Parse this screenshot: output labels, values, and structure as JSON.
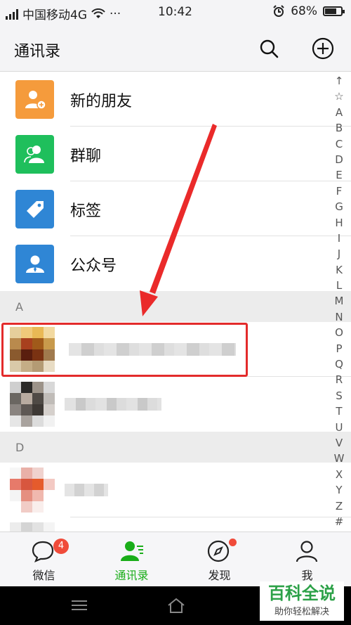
{
  "status_bar": {
    "carrier": "中国移动4G",
    "more": "···",
    "time": "10:42",
    "battery": "68%"
  },
  "header": {
    "title": "通讯录"
  },
  "functions": [
    {
      "label": "新的朋友",
      "color": "#f59b3c",
      "icon": "add-friend-icon"
    },
    {
      "label": "群聊",
      "color": "#1fbf5c",
      "icon": "group-chat-icon"
    },
    {
      "label": "标签",
      "color": "#2f86d5",
      "icon": "tag-icon"
    },
    {
      "label": "公众号",
      "color": "#2f86d5",
      "icon": "official-account-icon"
    }
  ],
  "sections": [
    "A",
    "D"
  ],
  "index_letters": [
    "↑",
    "☆",
    "A",
    "B",
    "C",
    "D",
    "E",
    "F",
    "G",
    "H",
    "I",
    "J",
    "K",
    "L",
    "M",
    "N",
    "O",
    "P",
    "Q",
    "R",
    "S",
    "T",
    "U",
    "V",
    "W",
    "X",
    "Y",
    "Z",
    "#"
  ],
  "tabs": [
    {
      "label": "微信",
      "badge": "4",
      "active": false
    },
    {
      "label": "通讯录",
      "active": true
    },
    {
      "label": "发现",
      "active": false
    },
    {
      "label": "我",
      "active": false
    }
  ],
  "watermark": {
    "title": "百科全说",
    "subtitle": "助你轻松解决"
  },
  "colors": {
    "accent": "#1aad19",
    "highlight": "#e32b2b",
    "badge": "#f04b3a"
  }
}
